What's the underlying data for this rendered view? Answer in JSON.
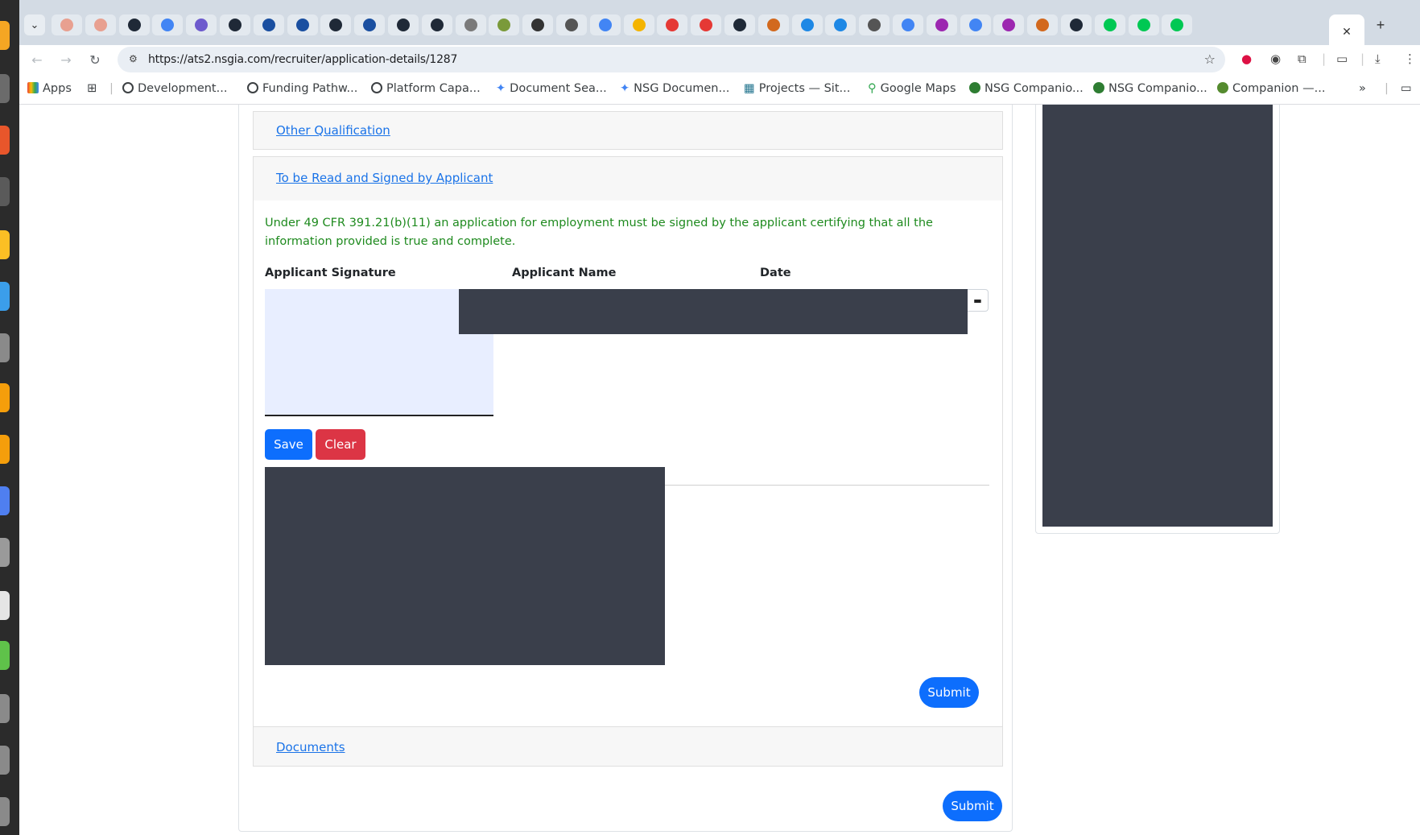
{
  "browser": {
    "url": "https://ats2.nsgia.com/recruiter/application-details/1287",
    "tab_count": 34,
    "bookmarks": [
      {
        "label": "Apps"
      },
      {
        "label": "Development..."
      },
      {
        "label": "Funding Pathw..."
      },
      {
        "label": "Platform Capa..."
      },
      {
        "label": "Document Sea..."
      },
      {
        "label": "NSG Documen..."
      },
      {
        "label": "Projects — Sit..."
      },
      {
        "label": "Google Maps"
      },
      {
        "label": "NSG Companio..."
      },
      {
        "label": "NSG Companio..."
      },
      {
        "label": "Companion —..."
      }
    ],
    "bookmarks_more": "»"
  },
  "page": {
    "sections": {
      "other_qualification": "Other Qualification",
      "to_be_read": "To be Read and Signed by Applicant",
      "documents": "Documents"
    },
    "signing": {
      "notice": "Under 49 CFR 391.21(b)(11) an application for employment must be signed by the applicant certifying that all the information provided is true and complete.",
      "col_signature": "Applicant Signature",
      "col_name": "Applicant Name",
      "col_date": "Date",
      "save_label": "Save",
      "clear_label": "Clear",
      "submit_label": "Submit"
    },
    "footer_submit_label": "Submit"
  },
  "colors": {
    "primary": "#0d6efd",
    "danger": "#dc3545",
    "notice_green": "#1e8a1e",
    "redaction": "#3a3f4b",
    "signature_pad": "#e8eeff"
  }
}
